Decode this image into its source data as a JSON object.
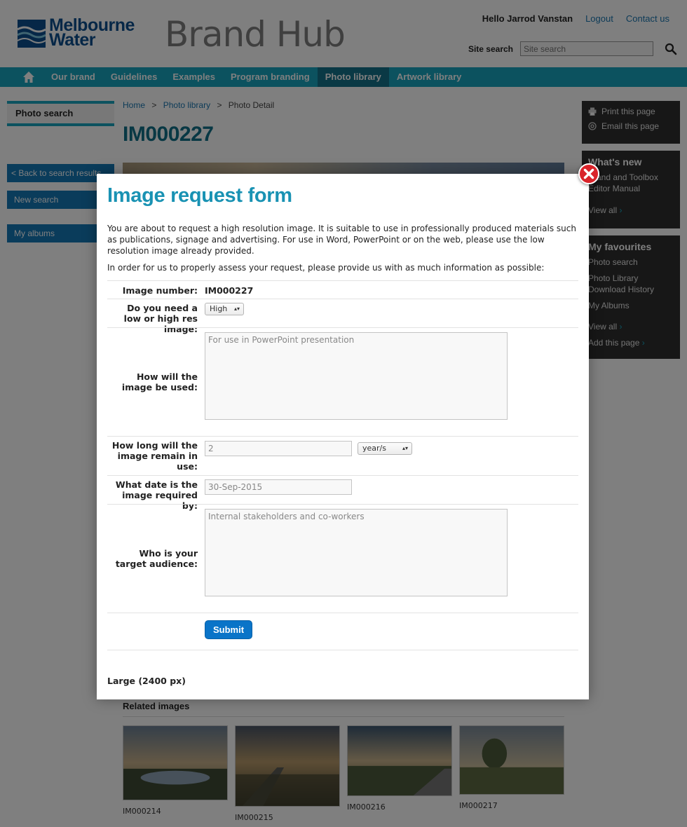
{
  "header": {
    "logo_line1": "Melbourne",
    "logo_line2": "Water",
    "site_name": "Brand Hub",
    "greeting": "Hello Jarrod Vanstan",
    "logout": "Logout",
    "contact": "Contact us",
    "search_label": "Site search",
    "search_placeholder": "Site search"
  },
  "nav": {
    "items": [
      {
        "label": "Our brand"
      },
      {
        "label": "Guidelines"
      },
      {
        "label": "Examples"
      },
      {
        "label": "Program branding"
      },
      {
        "label": "Photo library"
      },
      {
        "label": "Artwork library"
      }
    ],
    "active": "Photo library"
  },
  "left_sidebar": {
    "photo_search": "Photo search",
    "back": "< Back to search results",
    "new_search": "New search",
    "my_albums": "My albums"
  },
  "breadcrumb": {
    "home": "Home",
    "photo_library": "Photo library",
    "current": "Photo Detail",
    "separator": ">"
  },
  "page": {
    "title": "IM000227"
  },
  "right_sidebar": {
    "print": "Print this page",
    "email": "Email this page",
    "whats_new_heading": "What's new",
    "whats_new_text": "Brand and Toolbox Editor Manual",
    "whats_new_view_all": "View all",
    "favourites_heading": "My favourites",
    "favourites": [
      {
        "label": "Photo search"
      },
      {
        "label": "Photo Library Download History"
      },
      {
        "label": "My Albums"
      }
    ],
    "fav_view_all": "View all",
    "add_page": "Add this page"
  },
  "related": {
    "heading": "Related images",
    "items": [
      {
        "caption": "IM000214"
      },
      {
        "caption": "IM000215"
      },
      {
        "caption": "IM000216"
      },
      {
        "caption": "IM000217"
      }
    ]
  },
  "modal": {
    "title": "Image request form",
    "intro": "You are about to request a high resolution image. It is suitable to use in professionally produced materials such as publications, signage and advertising. For use in Word, PowerPoint or on the web, please use the low resolution image already provided.",
    "intro2": "In order for us to properly assess your request, please provide us with as much information as possible:",
    "fields": {
      "image_number_label": "Image number:",
      "image_number_value": "IM000227",
      "res_label": "Do you need a low or high res image:",
      "res_value": "High",
      "usage_label": "How will the image be used:",
      "usage_value": "For use in PowerPoint presentation",
      "duration_label": "How long will the image remain in use:",
      "duration_value": "2",
      "duration_unit": "year/s",
      "date_label": "What date is the image required by:",
      "date_value": "30-Sep-2015",
      "audience_label": "Who is your target audience:",
      "audience_value": "Internal stakeholders and co-workers"
    },
    "submit": "Submit",
    "size_note": "Large (2400 px)"
  },
  "colors": {
    "nav_bg": "#18a5bf",
    "nav_active": "#15738a",
    "title_teal": "#117189",
    "modal_title": "#1992b3",
    "button_blue": "#0a74c8",
    "close_red": "#d9232a"
  }
}
